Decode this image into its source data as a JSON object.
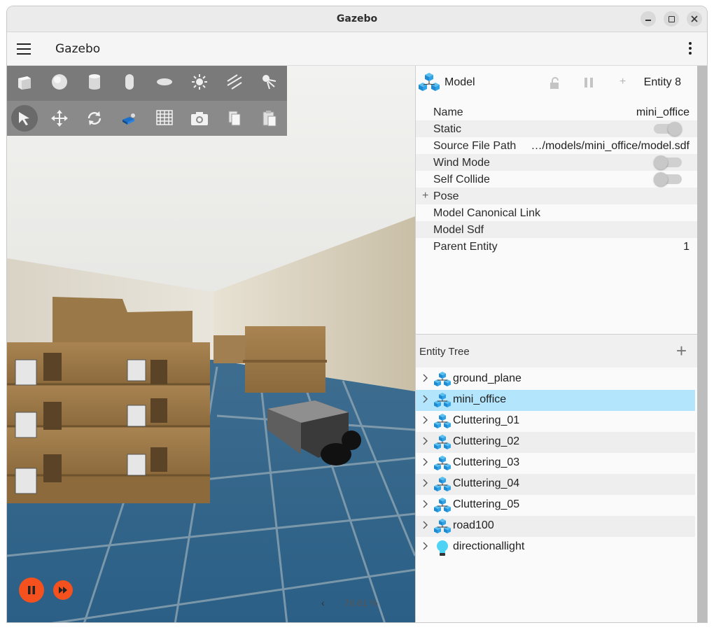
{
  "window": {
    "title": "Gazebo"
  },
  "appbar": {
    "title": "Gazebo"
  },
  "toolbar": {
    "row1": [
      "box-icon",
      "sphere-icon",
      "cylinder-icon",
      "capsule-icon",
      "ellipsoid-icon",
      "sun-icon",
      "directional-light-icon",
      "spot-light-icon"
    ],
    "row2": [
      "select-arrow-icon",
      "translate-icon",
      "rotate-icon",
      "snap-icon",
      "grid-icon",
      "camera-icon",
      "copy-icon",
      "paste-icon"
    ]
  },
  "playback": {
    "real_time_factor": "76.61 %",
    "chevron": "‹"
  },
  "component_inspector": {
    "header": {
      "label": "Model",
      "entity": "Entity 8",
      "plus": "+"
    },
    "properties": [
      {
        "key": "Name",
        "value": "mini_office",
        "type": "text"
      },
      {
        "key": "Static",
        "value": "",
        "type": "toggle",
        "on": true
      },
      {
        "key": "Source File Path",
        "value": "…/models/mini_office/model.sdf",
        "type": "text"
      },
      {
        "key": "Wind Mode",
        "value": "",
        "type": "toggle",
        "on": false
      },
      {
        "key": "Self Collide",
        "value": "",
        "type": "toggle",
        "on": false
      },
      {
        "key": "Pose",
        "value": "",
        "type": "expand"
      },
      {
        "key": "Model Canonical Link",
        "value": "",
        "type": "text"
      },
      {
        "key": "Model Sdf",
        "value": "",
        "type": "text"
      },
      {
        "key": "Parent Entity",
        "value": "1",
        "type": "text"
      }
    ]
  },
  "entity_tree": {
    "title": "Entity Tree",
    "add_label": "+",
    "items": [
      {
        "name": "ground_plane",
        "icon": "model-icon"
      },
      {
        "name": "mini_office",
        "icon": "model-icon",
        "selected": true
      },
      {
        "name": "Cluttering_01",
        "icon": "model-icon"
      },
      {
        "name": "Cluttering_02",
        "icon": "model-icon"
      },
      {
        "name": "Cluttering_03",
        "icon": "model-icon"
      },
      {
        "name": "Cluttering_04",
        "icon": "model-icon"
      },
      {
        "name": "Cluttering_05",
        "icon": "model-icon"
      },
      {
        "name": "road100",
        "icon": "model-icon"
      },
      {
        "name": "directionallight",
        "icon": "light-bulb-icon"
      }
    ]
  },
  "colors": {
    "accent": "#f4511e",
    "selection": "#b3e5fc",
    "model_icon": "#1e88e5"
  }
}
